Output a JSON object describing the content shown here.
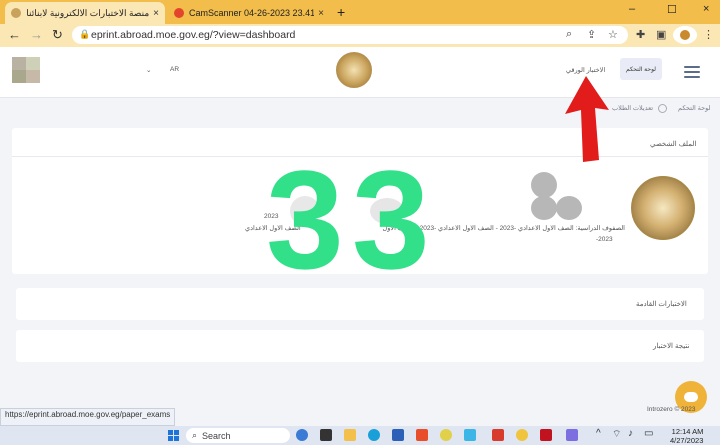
{
  "tabs": [
    {
      "title": "منصة الاختبارات الالكترونية لابنائنا ه",
      "close": "×",
      "fav_color": "#c9a35c"
    },
    {
      "title": "CamScanner 04-26-2023 23.41",
      "close": "×",
      "fav_color": "#e2452b"
    }
  ],
  "new_tab": "+",
  "window_controls": {
    "minimize": "–",
    "maximize": "☐",
    "close": "×"
  },
  "address": {
    "url": "eprint.abroad.moe.gov.eg/?view=dashboard"
  },
  "header": {
    "lang": "AR",
    "dropdown": "⌄",
    "exam_link": "الاختبار الورقي",
    "dashboard_button": "لوحة التحكم"
  },
  "breadcrumb": {
    "home": "لوحة التحكم",
    "current": "تعديلات الطلاب"
  },
  "profile": {
    "title": "الملف الشخصي",
    "line1": "الصفوف الدراسية: الصف الاول الاعدادي -2023 - الصف الاول الاعدادي -2023 - الصف الاول",
    "line2": "-2023",
    "right_year": "2023",
    "right_line": "الصف الاول الاعدادي"
  },
  "sections": [
    {
      "title": "الاختبارات القادمة"
    },
    {
      "title": "نتيجة الاختبار"
    }
  ],
  "overlay_number": "33",
  "footer_text": "Introzero © 2023",
  "status_url": "https://eprint.abroad.moe.gov.eg/paper_exams",
  "taskbar": {
    "search_placeholder": "Search",
    "time": "12:14 AM",
    "date": "4/27/2023"
  }
}
